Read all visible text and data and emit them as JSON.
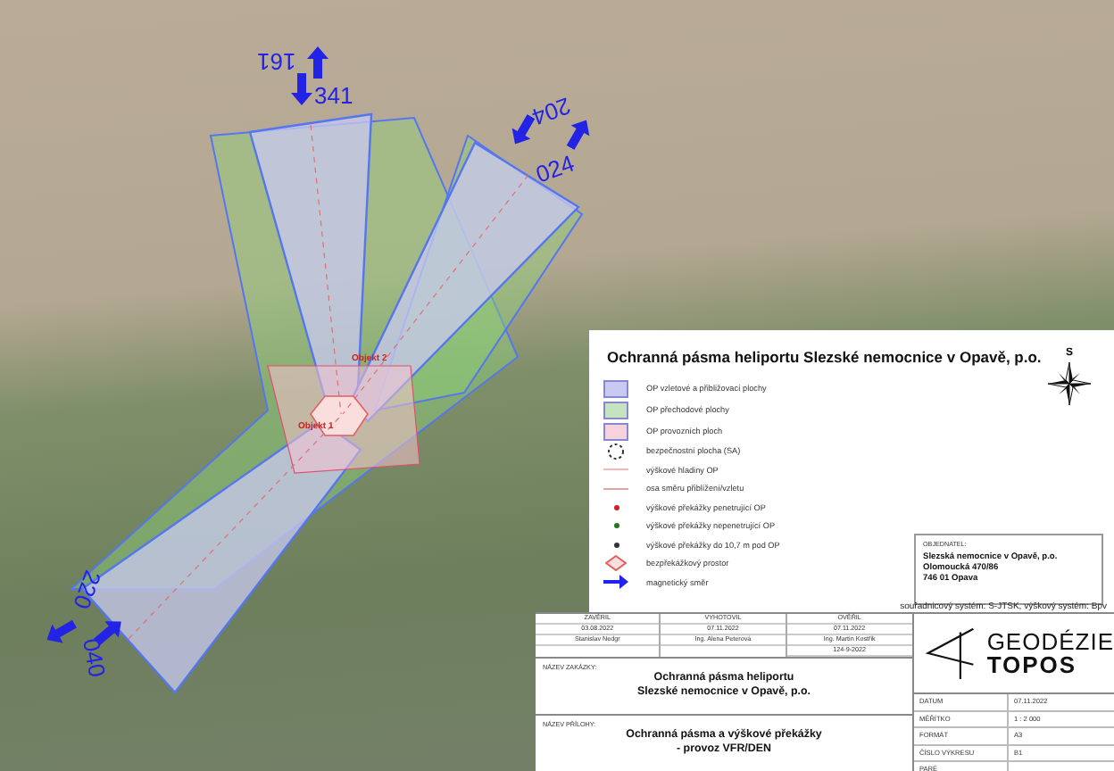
{
  "map": {
    "directions": [
      {
        "label": "161"
      },
      {
        "label": "341"
      },
      {
        "label": "204"
      },
      {
        "label": "024"
      },
      {
        "label": "220"
      },
      {
        "label": "040"
      }
    ],
    "objects": [
      {
        "label": "Objekt 2"
      },
      {
        "label": "Objekt 1"
      }
    ]
  },
  "legend": {
    "title": "Ochranná pásma heliportu Slezské nemocnice v Opavě, p.o.",
    "north_label": "S",
    "items": [
      {
        "kind": "swatch",
        "color": "#c9c9f2",
        "label": "OP vzletové a přibližovací plochy"
      },
      {
        "kind": "swatch",
        "color": "#c6e3bf",
        "label": "OP přechodové plochy"
      },
      {
        "kind": "swatch",
        "color": "#f6d3dc",
        "label": "OP provozních ploch"
      },
      {
        "kind": "circle",
        "color": "#333333",
        "label": "bezpečnostní plocha (SA)"
      },
      {
        "kind": "line",
        "color": "#f2b8b8",
        "label": "výškové hladiny OP"
      },
      {
        "kind": "line",
        "color": "#e8a0a0",
        "label": "osa směru přiblížení/vzletu"
      },
      {
        "kind": "dot",
        "color": "#cc2222",
        "label": "výškové překážky penetrující OP"
      },
      {
        "kind": "dot",
        "color": "#227722",
        "label": "výškové překážky nepenetrující OP"
      },
      {
        "kind": "dot",
        "color": "#333333",
        "label": "výškové překážky do 10,7 m pod OP"
      },
      {
        "kind": "diamond",
        "color": "#e06060",
        "label": "bezpřekážkový prostor"
      },
      {
        "kind": "arrow",
        "color": "#2222ee",
        "label": "magnetický směr"
      }
    ]
  },
  "client": {
    "heading": "OBJEDNATEL:",
    "name": "Slezská nemocnice v Opavě, p.o.",
    "street": "Olomoucká 470/86",
    "city": "746 01 Opava"
  },
  "coordinate_system": "souřadnicový systém: S-JTSK, výškový systém: Bpv",
  "title_block": {
    "columns": [
      {
        "heading": "ZAVĚRIL",
        "cells": [
          "03.08.2022",
          "Stanislav Nedgr"
        ]
      },
      {
        "heading": "VYHOTOVIL",
        "cells": [
          "07.11.2022",
          "Ing. Alena Peterová"
        ]
      },
      {
        "heading": "OVĚŘIL",
        "cells": [
          "07.11.2022",
          "Ing. Martin Kostřik",
          "124-9-2022"
        ]
      }
    ],
    "project": {
      "heading": "NÁZEV ZAKÁZKY:",
      "lines": [
        "Ochranná pásma heliportu",
        "Slezské nemocnice v Opavě, p.o."
      ]
    },
    "attachment": {
      "heading": "NÁZEV PŘÍLOHY:",
      "lines": [
        "Ochranná pásma a výškové překážky",
        "- provoz VFR/DEN"
      ]
    },
    "logo": {
      "line1": "GEODÉZIE",
      "line2": "TOPOS"
    },
    "info": [
      {
        "label": "DATUM",
        "value": "07.11.2022"
      },
      {
        "label": "MĚŘÍTKO",
        "value": "1 : 2 000"
      },
      {
        "label": "FORMÁT",
        "value": "A3"
      },
      {
        "label": "ČÍSLO VÝKRESU",
        "value": "B1"
      },
      {
        "label": "PARÉ"
      }
    ]
  }
}
